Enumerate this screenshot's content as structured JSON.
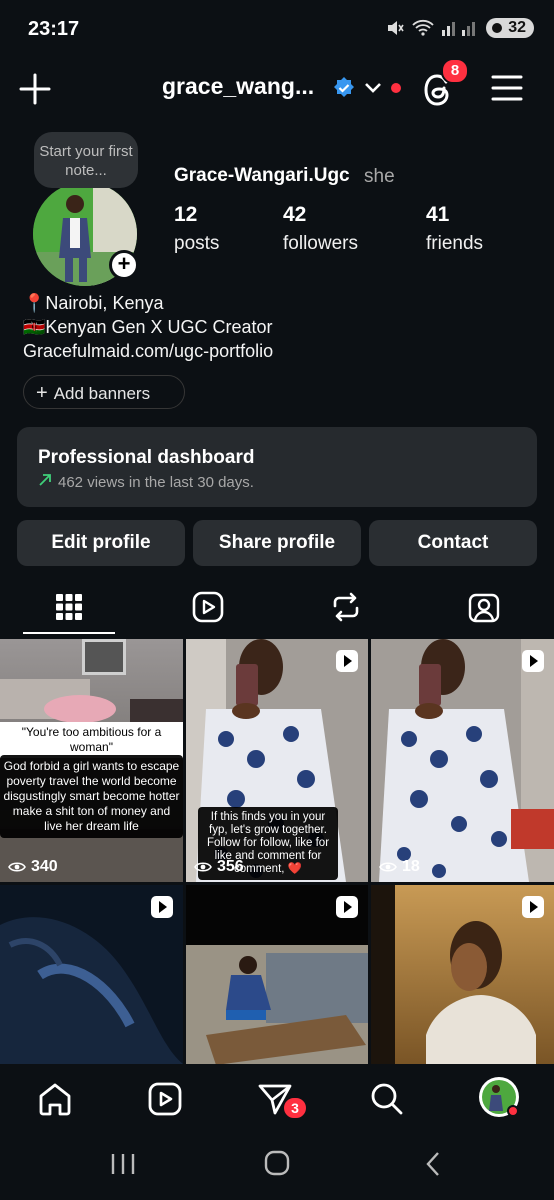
{
  "status_bar": {
    "time": "23:17",
    "battery": "32"
  },
  "header": {
    "username": "grace_wang...",
    "threads_badge": "8"
  },
  "profile": {
    "note_prompt": "Start your first note...",
    "display_name": "Grace-Wangari.Ugc",
    "pronouns": "she",
    "stats": [
      {
        "value": "12",
        "label": "posts"
      },
      {
        "value": "42",
        "label": "followers"
      },
      {
        "value": "41",
        "label": "friends"
      }
    ],
    "bio": [
      "📍Nairobi, Kenya",
      "🇰🇪Kenyan Gen X UGC Creator",
      "Gracefulmaid.com/ugc-portfolio"
    ],
    "add_banners": "Add banners"
  },
  "dashboard": {
    "title": "Professional dashboard",
    "subtitle": "462 views in the last 30 days."
  },
  "buttons": {
    "edit": "Edit profile",
    "share": "Share profile",
    "contact": "Contact"
  },
  "posts": [
    {
      "views": "340",
      "quote": "\"You're too ambitious for a woman\"",
      "caption": "God forbid a girl wants to escape poverty travel the world become disgustingly smart become hotter make a shit ton of money and live her dream life"
    },
    {
      "views": "356",
      "caption": "If this finds you in your fyp, let's grow together. Follow for follow, like for like and comment for comment, ❤️"
    },
    {
      "views": "18"
    },
    {},
    {},
    {}
  ],
  "bottom_nav": {
    "messages_badge": "3"
  },
  "colors": {
    "background": "#0c1014",
    "surface": "#262a2e",
    "badge": "#ff3040",
    "verified": "#3897f0",
    "trend": "#3fd07a"
  }
}
